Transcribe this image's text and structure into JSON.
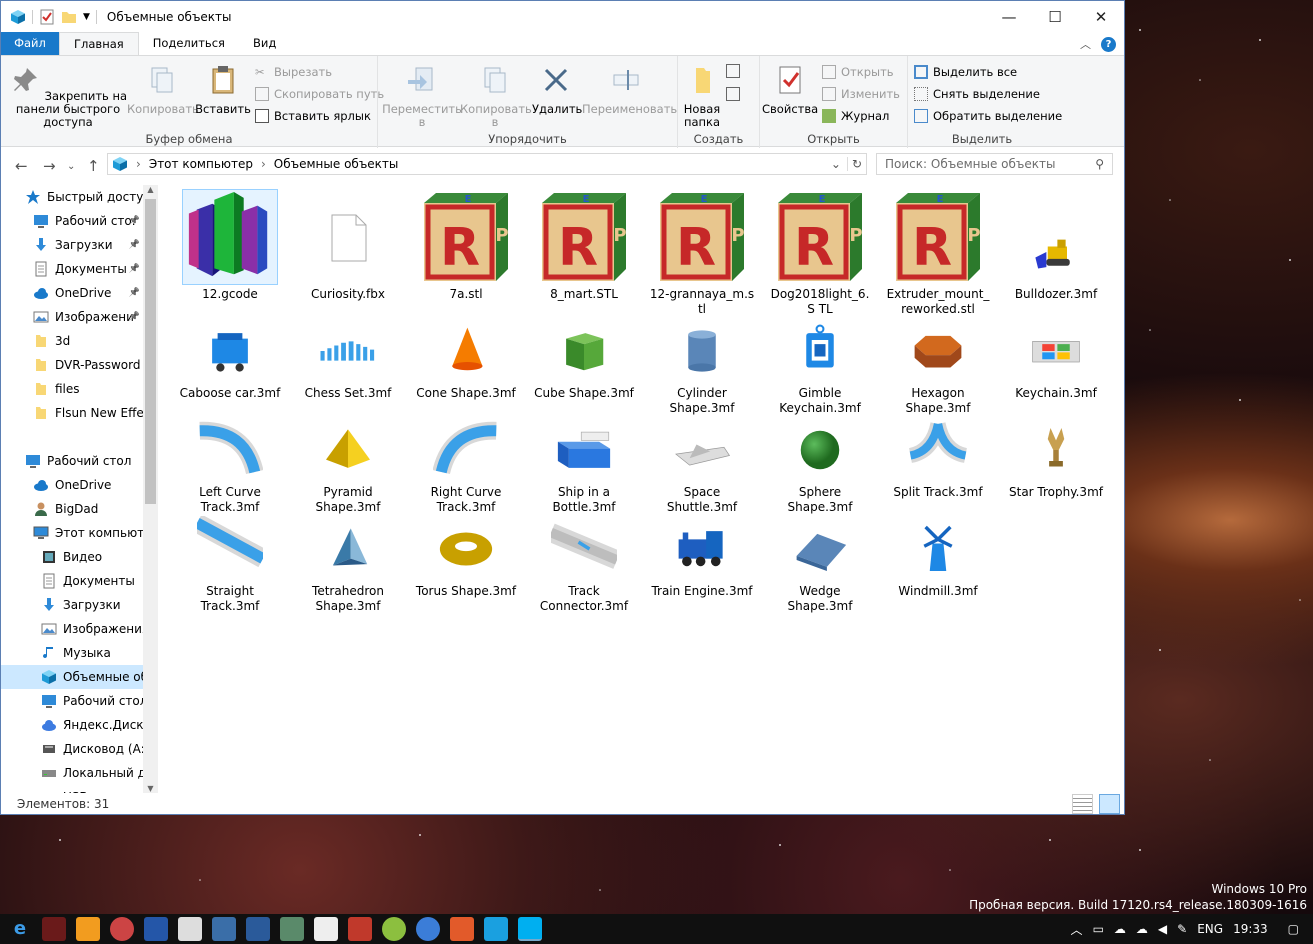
{
  "window": {
    "title": "Объемные объекты",
    "controls": {
      "minimize": "—",
      "maximize": "☐",
      "close": "✕"
    }
  },
  "ribbon_tabs": [
    "Файл",
    "Главная",
    "Поделиться",
    "Вид"
  ],
  "ribbon": {
    "clipboard": {
      "pin": "Закрепить на панели быстрого доступа",
      "copy": "Копировать",
      "paste": "Вставить",
      "cut": "Вырезать",
      "copy_path": "Скопировать путь",
      "paste_shortcut": "Вставить ярлык",
      "label": "Буфер обмена"
    },
    "organize": {
      "move": "Переместить в",
      "copy_to": "Копировать в",
      "delete": "Удалить",
      "rename": "Переименовать",
      "label": "Упорядочить"
    },
    "new": {
      "new_folder": "Новая папка",
      "label": "Создать"
    },
    "open": {
      "properties": "Свойства",
      "open": "Открыть",
      "edit": "Изменить",
      "history": "Журнал",
      "label": "Открыть"
    },
    "select": {
      "select_all": "Выделить все",
      "select_none": "Снять выделение",
      "invert": "Обратить выделение",
      "label": "Выделить"
    }
  },
  "address": {
    "crumbs": [
      "Этот компьютер",
      "Объемные объекты"
    ],
    "search_placeholder": "Поиск: Объемные объекты"
  },
  "nav": [
    {
      "label": "Быстрый доступ",
      "icon": "star-icon",
      "indent": 1,
      "pin": false
    },
    {
      "label": "Рабочий сто.",
      "icon": "desktop-icon",
      "indent": 2,
      "pin": true
    },
    {
      "label": "Загрузки",
      "icon": "download-icon",
      "indent": 2,
      "pin": true
    },
    {
      "label": "Документы",
      "icon": "documents-icon",
      "indent": 2,
      "pin": true
    },
    {
      "label": "OneDrive",
      "icon": "cloud-icon",
      "indent": 2,
      "pin": true
    },
    {
      "label": "Изображени",
      "icon": "pictures-icon",
      "indent": 2,
      "pin": true
    },
    {
      "label": "3d",
      "icon": "folder-icon",
      "indent": 2,
      "pin": false
    },
    {
      "label": "DVR-Password",
      "icon": "folder-icon",
      "indent": 2,
      "pin": false
    },
    {
      "label": "files",
      "icon": "folder-icon",
      "indent": 2,
      "pin": false
    },
    {
      "label": "Flsun New Effect",
      "icon": "folder-icon",
      "indent": 2,
      "pin": false
    },
    {
      "label": "",
      "icon": "",
      "indent": 0,
      "pin": false
    },
    {
      "label": "Рабочий стол",
      "icon": "desktop-icon",
      "indent": 1,
      "pin": false
    },
    {
      "label": "OneDrive",
      "icon": "cloud-icon",
      "indent": 2,
      "pin": false
    },
    {
      "label": "BigDad",
      "icon": "user-icon",
      "indent": 2,
      "pin": false
    },
    {
      "label": "Этот компьютер",
      "icon": "computer-icon",
      "indent": 2,
      "pin": false
    },
    {
      "label": "Видео",
      "icon": "video-icon",
      "indent": 3,
      "pin": false
    },
    {
      "label": "Документы",
      "icon": "documents-icon",
      "indent": 3,
      "pin": false
    },
    {
      "label": "Загрузки",
      "icon": "download-icon",
      "indent": 3,
      "pin": false
    },
    {
      "label": "Изображения",
      "icon": "pictures-icon",
      "indent": 3,
      "pin": false
    },
    {
      "label": "Музыка",
      "icon": "music-icon",
      "indent": 3,
      "pin": false
    },
    {
      "label": "Объемные об",
      "icon": "3d-objects-icon",
      "indent": 3,
      "pin": false,
      "selected": true
    },
    {
      "label": "Рабочий стол",
      "icon": "desktop-icon",
      "indent": 3,
      "pin": false
    },
    {
      "label": "Яндекс.Диск",
      "icon": "yandex-disk-icon",
      "indent": 3,
      "pin": false
    },
    {
      "label": "Дисковод (A:)",
      "icon": "floppy-icon",
      "indent": 3,
      "pin": false
    },
    {
      "label": "Локальный ди",
      "icon": "drive-icon",
      "indent": 3,
      "pin": false
    },
    {
      "label": "USB-накопите",
      "icon": "usb-icon",
      "indent": 3,
      "pin": false
    }
  ],
  "files": [
    {
      "name": "12.gcode",
      "icon": "gcode-thumb"
    },
    {
      "name": "Curiosity.fbx",
      "icon": "blank-file-thumb"
    },
    {
      "name": "7a.stl",
      "icon": "rp-cube-thumb"
    },
    {
      "name": "8_mart.STL",
      "icon": "rp-cube-thumb"
    },
    {
      "name": "12-grannaya_m.s tl",
      "icon": "rp-cube-thumb"
    },
    {
      "name": "Dog2018light_6.S TL",
      "icon": "rp-cube-thumb"
    },
    {
      "name": "Extruder_mount_ reworked.stl",
      "icon": "rp-cube-thumb"
    },
    {
      "name": "Bulldozer.3mf",
      "icon": "bulldozer-thumb"
    },
    {
      "name": "Caboose car.3mf",
      "icon": "caboose-thumb"
    },
    {
      "name": "Chess Set.3mf",
      "icon": "chess-thumb"
    },
    {
      "name": "Cone Shape.3mf",
      "icon": "cone-thumb"
    },
    {
      "name": "Cube Shape.3mf",
      "icon": "cube-thumb"
    },
    {
      "name": "Cylinder Shape.3mf",
      "icon": "cylinder-thumb"
    },
    {
      "name": "Gimble Keychain.3mf",
      "icon": "gimble-thumb"
    },
    {
      "name": "Hexagon Shape.3mf",
      "icon": "hexagon-thumb"
    },
    {
      "name": "Keychain.3mf",
      "icon": "keychain-thumb"
    },
    {
      "name": "Left Curve Track.3mf",
      "icon": "left-curve-thumb"
    },
    {
      "name": "Pyramid Shape.3mf",
      "icon": "pyramid-thumb"
    },
    {
      "name": "Right Curve Track.3mf",
      "icon": "right-curve-thumb"
    },
    {
      "name": "Ship in a Bottle.3mf",
      "icon": "ship-thumb"
    },
    {
      "name": "Space Shuttle.3mf",
      "icon": "shuttle-thumb"
    },
    {
      "name": "Sphere Shape.3mf",
      "icon": "sphere-thumb"
    },
    {
      "name": "Split Track.3mf",
      "icon": "split-track-thumb"
    },
    {
      "name": "Star Trophy.3mf",
      "icon": "trophy-thumb"
    },
    {
      "name": "Straight Track.3mf",
      "icon": "straight-track-thumb"
    },
    {
      "name": "Tetrahedron Shape.3mf",
      "icon": "tetrahedron-thumb"
    },
    {
      "name": "Torus Shape.3mf",
      "icon": "torus-thumb"
    },
    {
      "name": "Track Connector.3mf",
      "icon": "connector-thumb"
    },
    {
      "name": "Train Engine.3mf",
      "icon": "train-thumb"
    },
    {
      "name": "Wedge Shape.3mf",
      "icon": "wedge-thumb"
    },
    {
      "name": "Windmill.3mf",
      "icon": "windmill-thumb"
    }
  ],
  "status": {
    "count": "Элементов: 31"
  },
  "watermark": {
    "line1": "Windows 10 Pro",
    "line2": "Пробная версия. Build 17120.rs4_release.180309-1616"
  },
  "tray": {
    "lang": "ENG",
    "time": "19:33"
  },
  "colors": {
    "accent": "#1979ca",
    "selection": "#cce8ff"
  }
}
